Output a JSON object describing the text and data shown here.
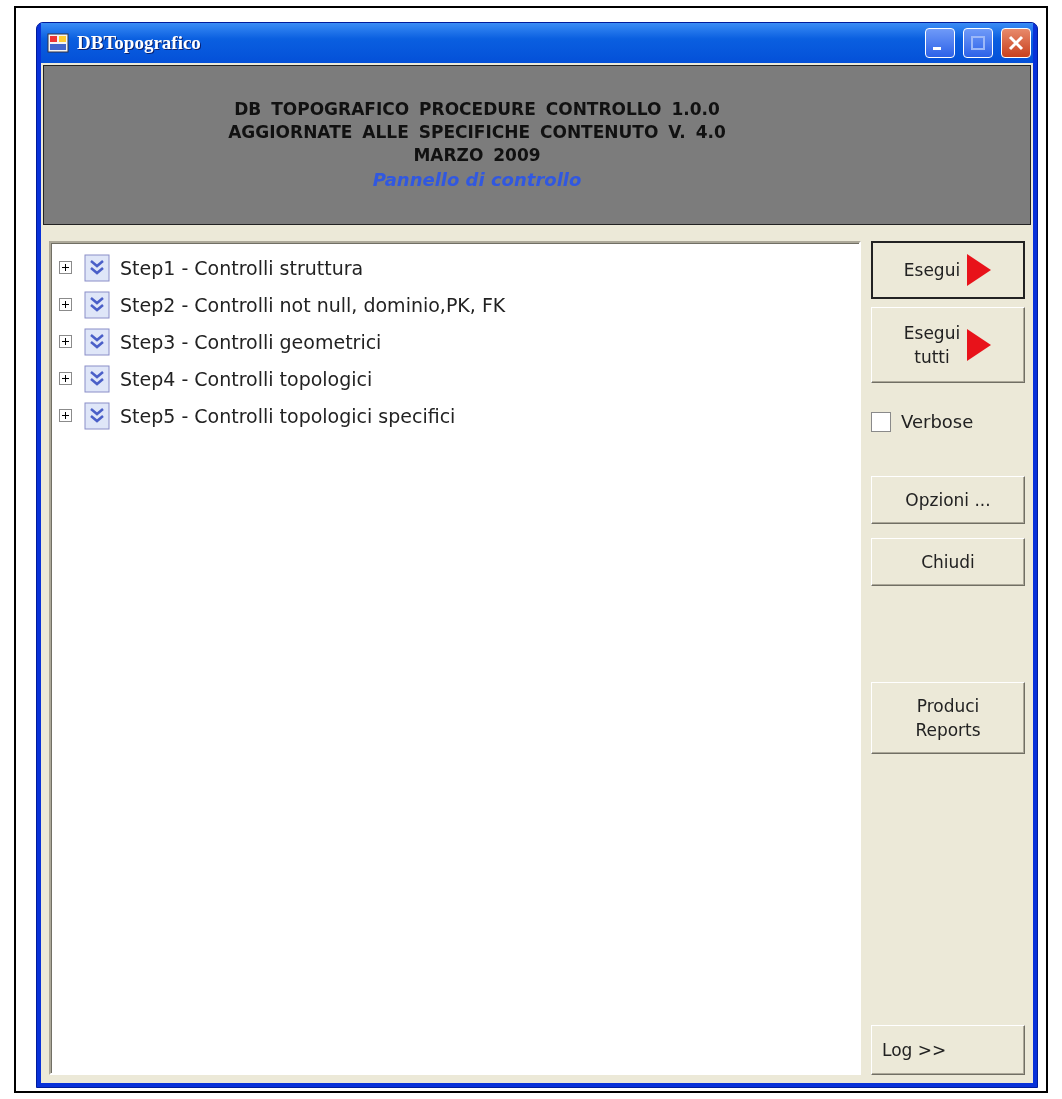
{
  "window": {
    "title": "DBTopografico"
  },
  "header": {
    "lines": [
      "DB TOPOGRAFICO PROCEDURE CONTROLLO 1.0.0",
      "AGGIORNATE ALLE SPECIFICHE CONTENUTO V. 4.0",
      "MARZO 2009"
    ],
    "subtitle": "Pannello di controllo"
  },
  "tree": {
    "items": [
      {
        "label": "Step1 - Controlli struttura",
        "expanded": false
      },
      {
        "label": "Step2 - Controlli not null, dominio,PK, FK",
        "expanded": false
      },
      {
        "label": "Step3 - Controlli geometrici",
        "expanded": false
      },
      {
        "label": "Step4 - Controlli topologici",
        "expanded": false
      },
      {
        "label": "Step5 - Controlli topologici specifici",
        "expanded": false
      }
    ]
  },
  "side": [
    {
      "kind": "run",
      "label": "Esegui",
      "focused": true
    },
    {
      "kind": "run",
      "label": "Esegui\ntutti",
      "focused": false
    },
    {
      "kind": "checkbox",
      "label": "Verbose",
      "checked": false
    },
    {
      "kind": "button",
      "label": "Opzioni ...",
      "focused": false
    },
    {
      "kind": "button",
      "label": "Chiudi",
      "focused": false
    },
    {
      "kind": "button",
      "label": "Produci\nReports",
      "focused": false
    },
    {
      "kind": "log",
      "label": "Log >>",
      "focused": false
    }
  ]
}
